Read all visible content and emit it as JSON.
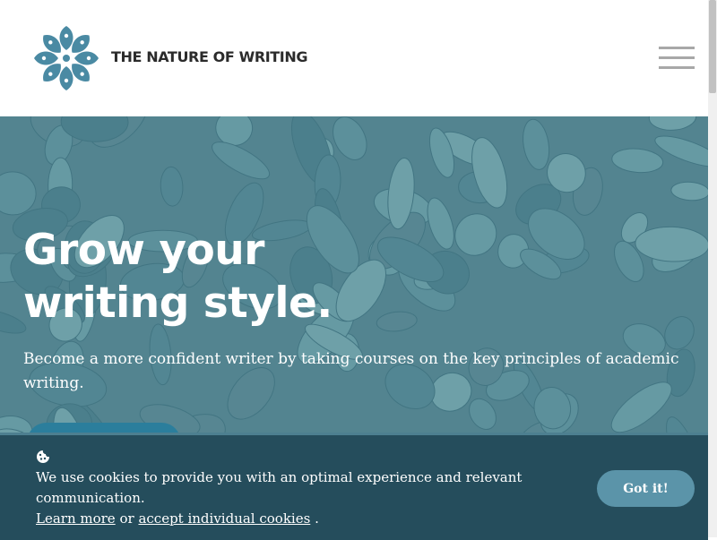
{
  "header": {
    "brand": "THE NATURE OF WRITING",
    "menu_icon": "hamburger-menu-icon",
    "logo_icon": "flower-logo-icon"
  },
  "hero": {
    "title_line1": "Grow your",
    "title_line2": "writing style.",
    "subtitle": "Become a more confident writer by taking courses on the key principles of academic writing."
  },
  "cookie": {
    "icon": "cookie-icon",
    "text": "We use cookies to provide you with an optimal experience and relevant communication.",
    "learn_more": "Learn more",
    "or_text": "or",
    "accept_individual": "accept individual cookies",
    "period": ".",
    "button": "Got it!"
  },
  "colors": {
    "brand_teal": "#4a8aa3",
    "banner_bg": "#254d5c",
    "button_bg": "#5b94a9"
  }
}
